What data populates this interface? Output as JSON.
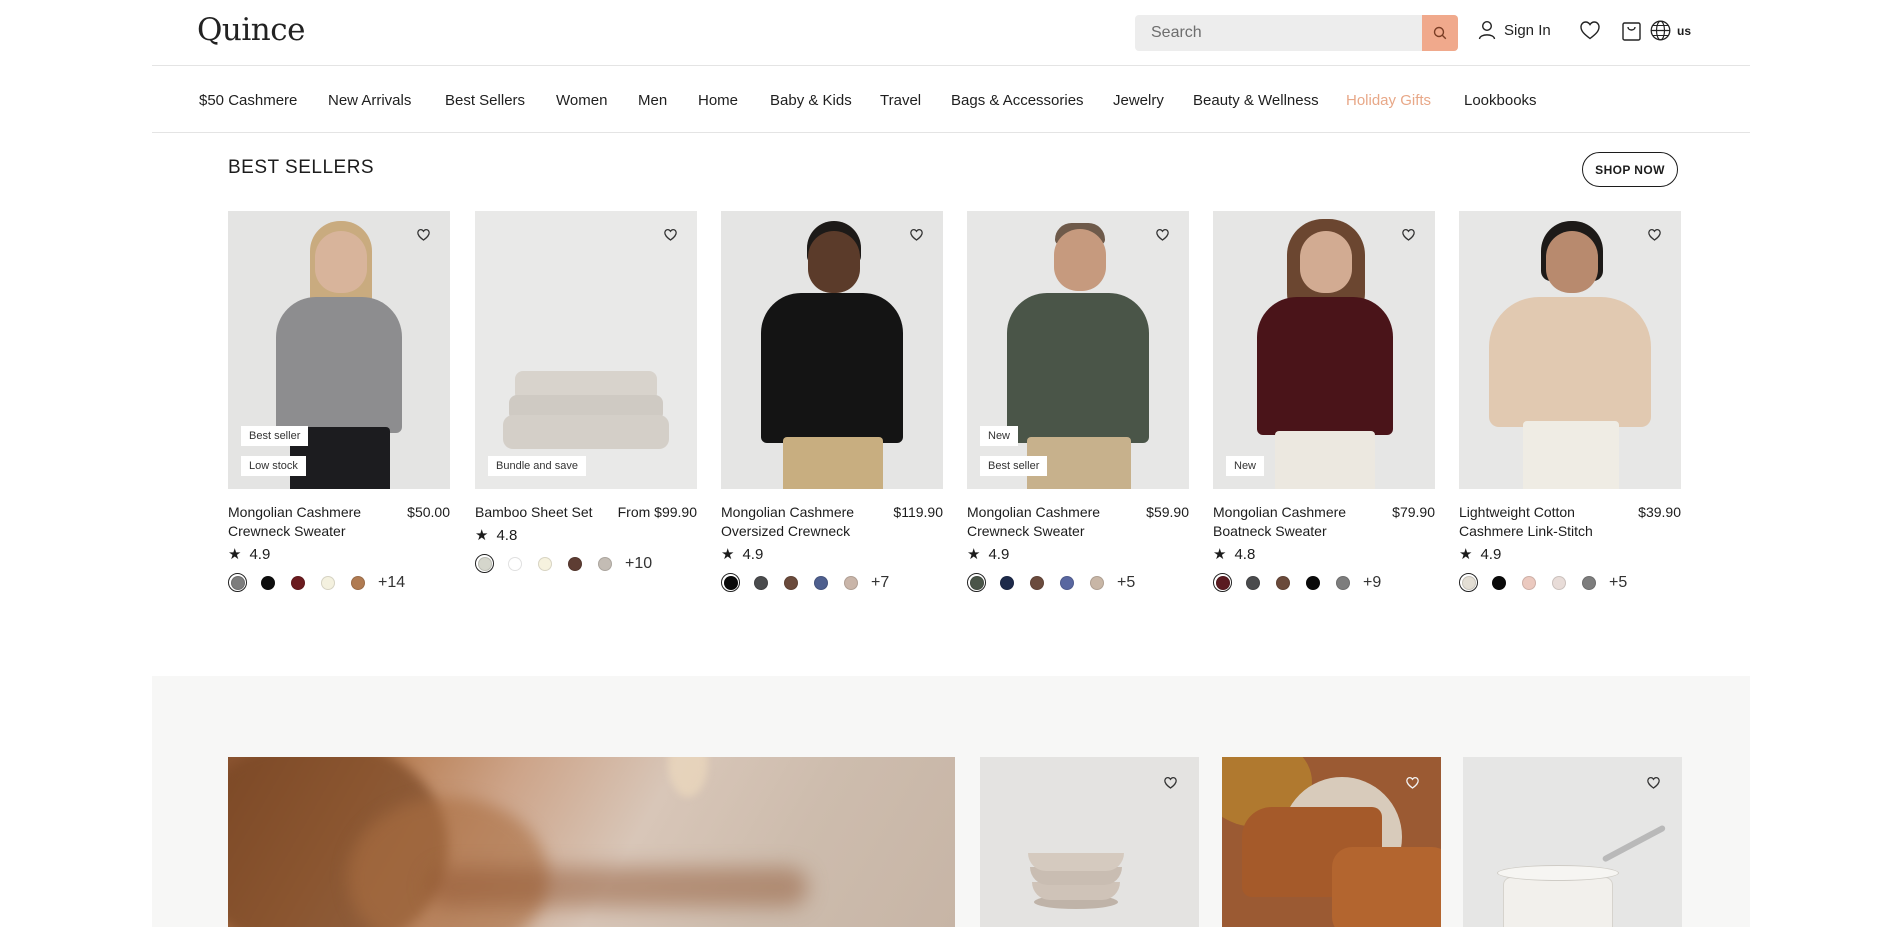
{
  "header": {
    "logo": "Quince",
    "search_placeholder": "Search",
    "sign_in": "Sign In",
    "region": "us"
  },
  "nav": [
    "$50 Cashmere",
    "New Arrivals",
    "Best Sellers",
    "Women",
    "Men",
    "Home",
    "Baby & Kids",
    "Travel",
    "Bags & Accessories",
    "Jewelry",
    "Beauty & Wellness",
    "Holiday Gifts",
    "Lookbooks"
  ],
  "colors": {
    "highlight": "#e8a888",
    "search_button": "#f0a98c"
  },
  "best_sellers": {
    "title": "BEST SELLERS",
    "cta": "SHOP NOW",
    "products": [
      {
        "name": "Mongolian Cashmere Crewneck Sweater",
        "price": "$50.00",
        "rating": "4.9",
        "badges": [
          "Best seller",
          "Low stock"
        ],
        "swatches": [
          "#7d7d7d",
          "#0d0d0d",
          "#6b1b1f",
          "#f4f1df",
          "#b07b52"
        ],
        "more": "+14"
      },
      {
        "name": "Bamboo Sheet Set",
        "price": "From $99.90",
        "rating": "4.8",
        "badges": [
          "Bundle and save"
        ],
        "swatches": [
          "#d5d6cc",
          "#ffffff",
          "#f6f2de",
          "#5e3d33",
          "#c3bcb4"
        ],
        "more": "+10"
      },
      {
        "name": "Mongolian Cashmere Oversized Crewneck Sweater",
        "price": "$119.90",
        "rating": "4.9",
        "badges": [],
        "swatches": [
          "#0a0a0a",
          "#4a4b4d",
          "#6a4a3b",
          "#4e5f8e",
          "#c9b5a9"
        ],
        "more": "+7"
      },
      {
        "name": "Mongolian Cashmere Crewneck Sweater",
        "price": "$59.90",
        "rating": "4.9",
        "badges": [
          "New",
          "Best seller"
        ],
        "swatches": [
          "#4a5549",
          "#1d2a4a",
          "#6b4b3d",
          "#5967a0",
          "#c8b6a6"
        ],
        "more": "+5"
      },
      {
        "name": "Mongolian Cashmere Boatneck Sweater",
        "price": "$79.90",
        "rating": "4.8",
        "badges": [
          "New"
        ],
        "swatches": [
          "#5a1a20",
          "#4a4b4d",
          "#6a4a3b",
          "#0a0a0a",
          "#7d7d7d"
        ],
        "more": "+9"
      },
      {
        "name": "Lightweight Cotton Cashmere Link-Stitch Sweater",
        "price": "$39.90",
        "rating": "4.9",
        "badges": [],
        "swatches": [
          "#e3ded4",
          "#0a0a0a",
          "#ebc9bf",
          "#e8dcd8",
          "#7d7d7d"
        ],
        "more": "+5"
      }
    ]
  }
}
